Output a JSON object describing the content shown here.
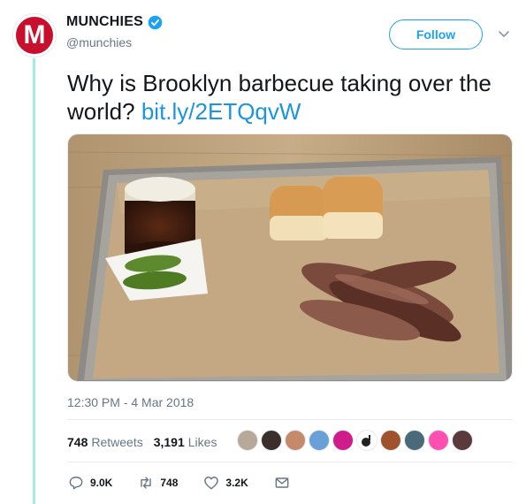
{
  "account": {
    "display_name": "MUNCHIES",
    "handle": "@munchies",
    "avatar_letter": "M",
    "verified": true,
    "avatar_color": "#c8102e"
  },
  "follow_label": "Follow",
  "tweet": {
    "text": "Why is Brooklyn barbecue taking over the world?",
    "link": "bit.ly/2ETQqvW",
    "timestamp": "12:30 PM - 4 Mar 2018"
  },
  "stats": {
    "retweets_count": "748",
    "retweets_label": "Retweets",
    "likes_count": "3,191",
    "likes_label": "Likes"
  },
  "actions": {
    "reply_count": "9.0K",
    "retweet_count": "748",
    "like_count": "3.2K"
  },
  "colors": {
    "accent": "#1da1f2",
    "link": "#1b95e0",
    "muted": "#657786",
    "thread_line": "#a2ede3"
  }
}
